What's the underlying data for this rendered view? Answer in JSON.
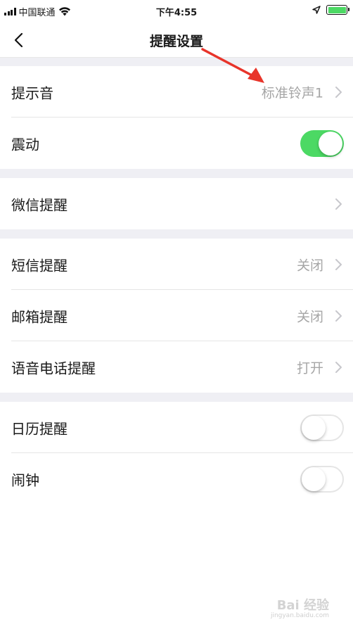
{
  "status_bar": {
    "carrier": "中国联通",
    "time": "下午4:55"
  },
  "nav": {
    "title": "提醒设置"
  },
  "sections": [
    {
      "rows": [
        {
          "label": "提示音",
          "value": "标准铃声1",
          "type": "link"
        },
        {
          "label": "震动",
          "type": "toggle",
          "toggle_on": true
        }
      ]
    },
    {
      "rows": [
        {
          "label": "微信提醒",
          "value": "",
          "type": "link"
        }
      ]
    },
    {
      "rows": [
        {
          "label": "短信提醒",
          "value": "关闭",
          "type": "link"
        },
        {
          "label": "邮箱提醒",
          "value": "关闭",
          "type": "link"
        },
        {
          "label": "语音电话提醒",
          "value": "打开",
          "type": "link"
        }
      ]
    },
    {
      "rows": [
        {
          "label": "日历提醒",
          "type": "toggle",
          "toggle_on": false
        },
        {
          "label": "闹钟",
          "type": "toggle",
          "toggle_on": false
        }
      ]
    }
  ],
  "colors": {
    "toggle_on": "#4cd964",
    "annotation_arrow": "#e8342a",
    "background_gap": "#efeff4"
  },
  "watermark": {
    "text": "Bai 经验",
    "sub": "jingyan.baidu.com"
  }
}
